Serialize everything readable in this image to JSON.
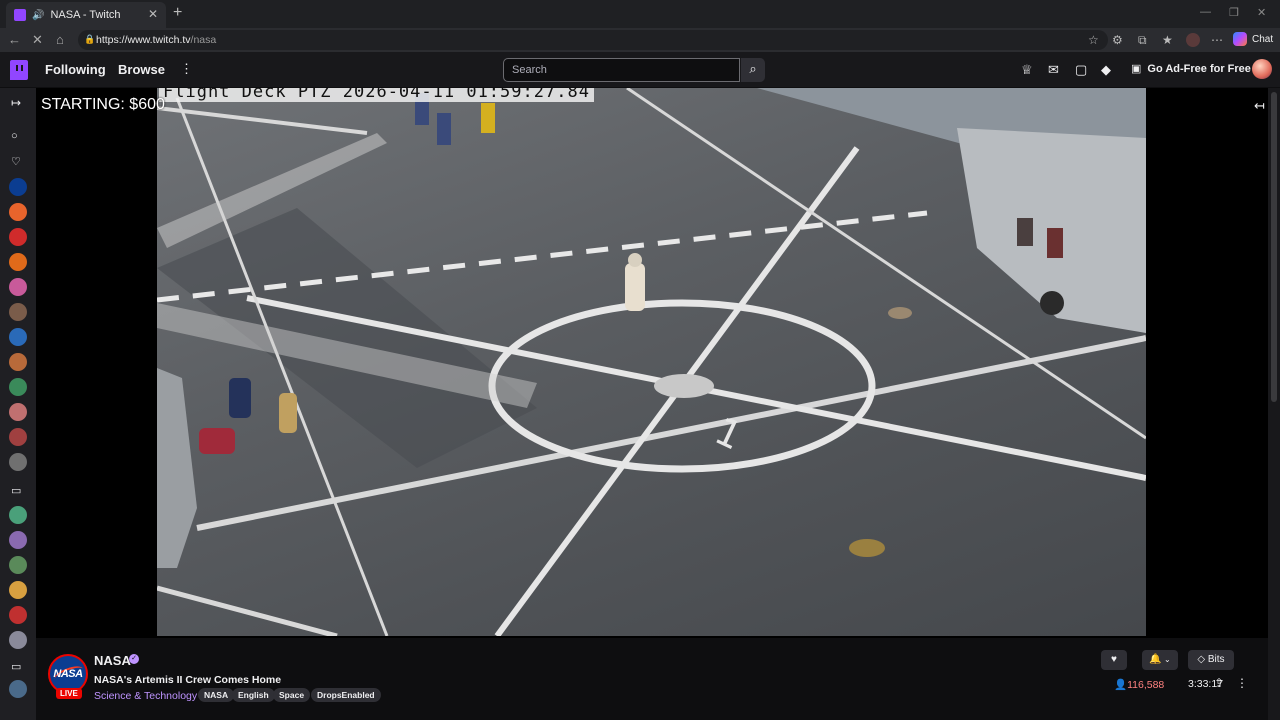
{
  "browser": {
    "tab_title": "NASA - Twitch",
    "url_domain": "https://www.twitch.tv",
    "url_path": "/nasa",
    "chat_label": "Chat"
  },
  "topnav": {
    "following": "Following",
    "browse": "Browse",
    "search_placeholder": "Search",
    "ad_free": "Go Ad-Free for Free"
  },
  "player": {
    "overlay_text": "STARTING: $600",
    "camera_timestamp": "Flight Deck PTZ 2026-04-11 01:59:27.84",
    "deck_marking": "1"
  },
  "channel": {
    "name": "NASA",
    "avatar_text": "NASA",
    "live_badge": "LIVE",
    "stream_title": "NASA's Artemis II Crew Comes Home",
    "category": "Science & Technology",
    "tags": [
      "NASA",
      "English",
      "Space",
      "DropsEnabled"
    ],
    "bits_label": "Bits",
    "viewer_count": "116,588",
    "uptime": "3:33:17"
  },
  "colors": {
    "twitch_purple": "#9146ff",
    "live_red": "#eb0400",
    "viewer_red": "#ff8280",
    "category_purple": "#bf94ff"
  },
  "icons": [
    "twitch-logo-icon",
    "speaker-icon",
    "search-icon",
    "prime-crown-icon",
    "inbox-icon",
    "whisper-icon",
    "bits-icon",
    "heart-icon",
    "bell-icon",
    "share-icon",
    "more-icon"
  ]
}
